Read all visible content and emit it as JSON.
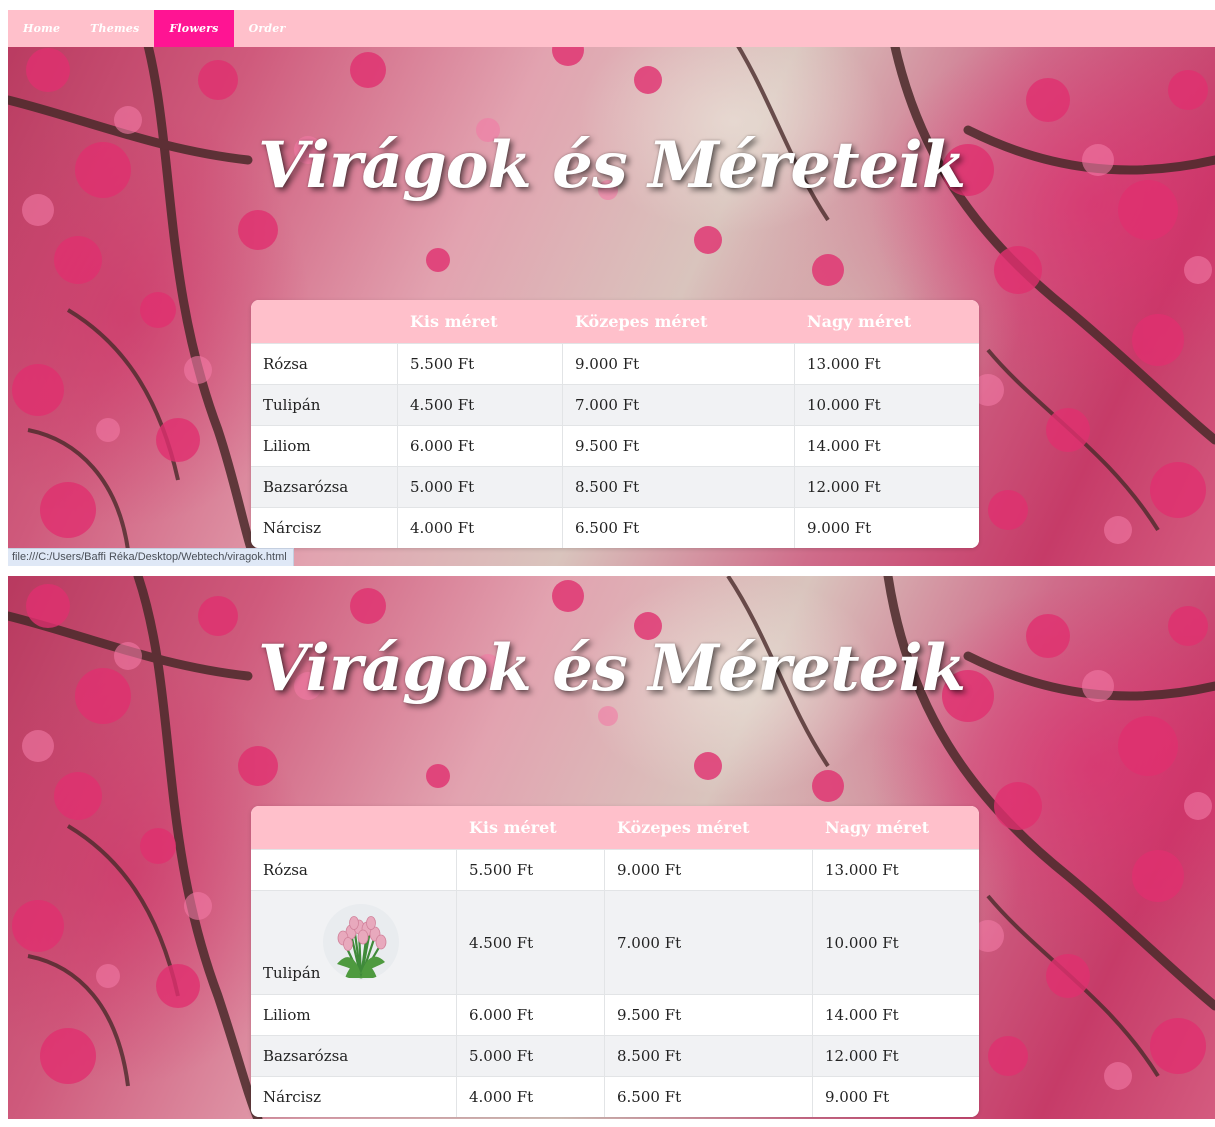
{
  "nav": {
    "items": [
      {
        "label": "Home"
      },
      {
        "label": "Themes"
      },
      {
        "label": "Flowers"
      },
      {
        "label": "Order"
      }
    ],
    "active_color": "#ff1493",
    "bar_color": "#ffc0cb"
  },
  "hero": {
    "title": "Virágok és Méreteik"
  },
  "table": {
    "headers": [
      "",
      "Kis méret",
      "Közepes méret",
      "Nagy méret"
    ],
    "rows": [
      {
        "name": "Rózsa",
        "small": "5.500 Ft",
        "medium": "9.000 Ft",
        "large": "13.000 Ft"
      },
      {
        "name": "Tulipán",
        "small": "4.500 Ft",
        "medium": "7.000 Ft",
        "large": "10.000 Ft"
      },
      {
        "name": "Liliom",
        "small": "6.000 Ft",
        "medium": "9.500 Ft",
        "large": "14.000 Ft"
      },
      {
        "name": "Bazsarózsa",
        "small": "5.000 Ft",
        "medium": "8.500 Ft",
        "large": "12.000 Ft"
      },
      {
        "name": "Nárcisz",
        "small": "4.000 Ft",
        "medium": "6.500 Ft",
        "large": "9.000 Ft"
      }
    ]
  },
  "status_bar": {
    "url": "file:///C:/Users/Baffi Réka/Desktop/Webtech/viragok.html"
  }
}
